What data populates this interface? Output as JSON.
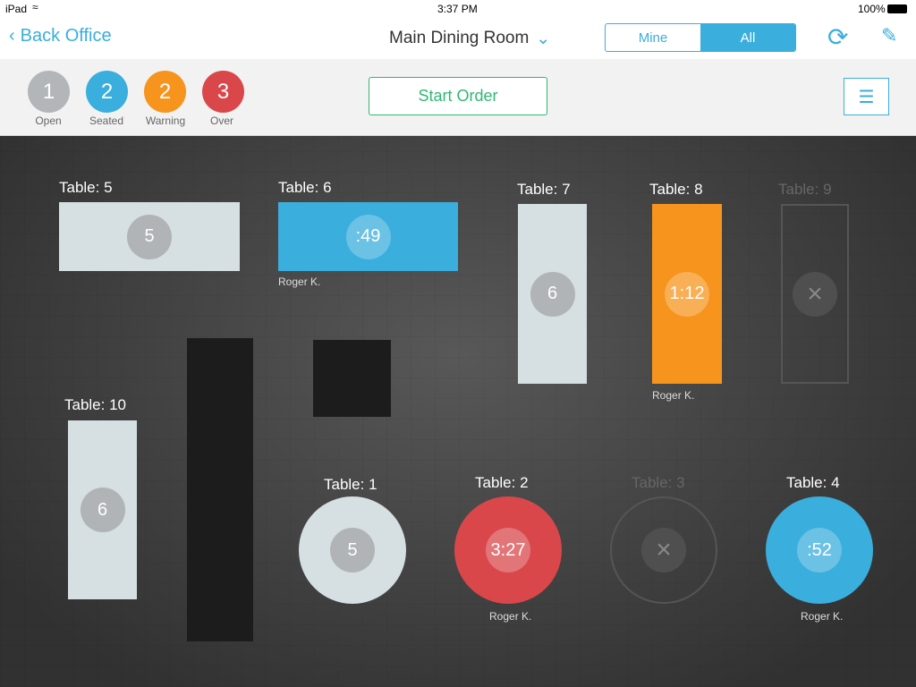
{
  "status_bar": {
    "device": "iPad",
    "time": "3:37 PM",
    "battery": "100%"
  },
  "nav": {
    "back_label": "Back Office",
    "room_title": "Main Dining Room",
    "filter": {
      "options": [
        "Mine",
        "All"
      ],
      "selected": "All"
    }
  },
  "toolbar": {
    "start_order_label": "Start Order",
    "counts": [
      {
        "count": "1",
        "label": "Open",
        "color": "#b3b6b8"
      },
      {
        "count": "2",
        "label": "Seated",
        "color": "#3aaedd"
      },
      {
        "count": "2",
        "label": "Warning",
        "color": "#f7941d"
      },
      {
        "count": "3",
        "label": "Over",
        "color": "#d9474b"
      }
    ]
  },
  "tables": {
    "t5": {
      "label": "Table: 5",
      "value": "5",
      "state": "open"
    },
    "t6": {
      "label": "Table: 6",
      "value": ":49",
      "state": "seated",
      "server": "Roger K."
    },
    "t7": {
      "label": "Table: 7",
      "value": "6",
      "state": "open"
    },
    "t8": {
      "label": "Table: 8",
      "value": "1:12",
      "state": "warning",
      "server": "Roger K."
    },
    "t9": {
      "label": "Table: 9",
      "state": "unavailable"
    },
    "t10": {
      "label": "Table: 10",
      "value": "6",
      "state": "open"
    },
    "t1": {
      "label": "Table: 1",
      "value": "5",
      "state": "open"
    },
    "t2": {
      "label": "Table: 2",
      "value": "3:27",
      "state": "over",
      "server": "Roger K."
    },
    "t3": {
      "label": "Table: 3",
      "state": "unavailable"
    },
    "t4": {
      "label": "Table: 4",
      "value": ":52",
      "state": "seated",
      "server": "Roger K."
    }
  }
}
